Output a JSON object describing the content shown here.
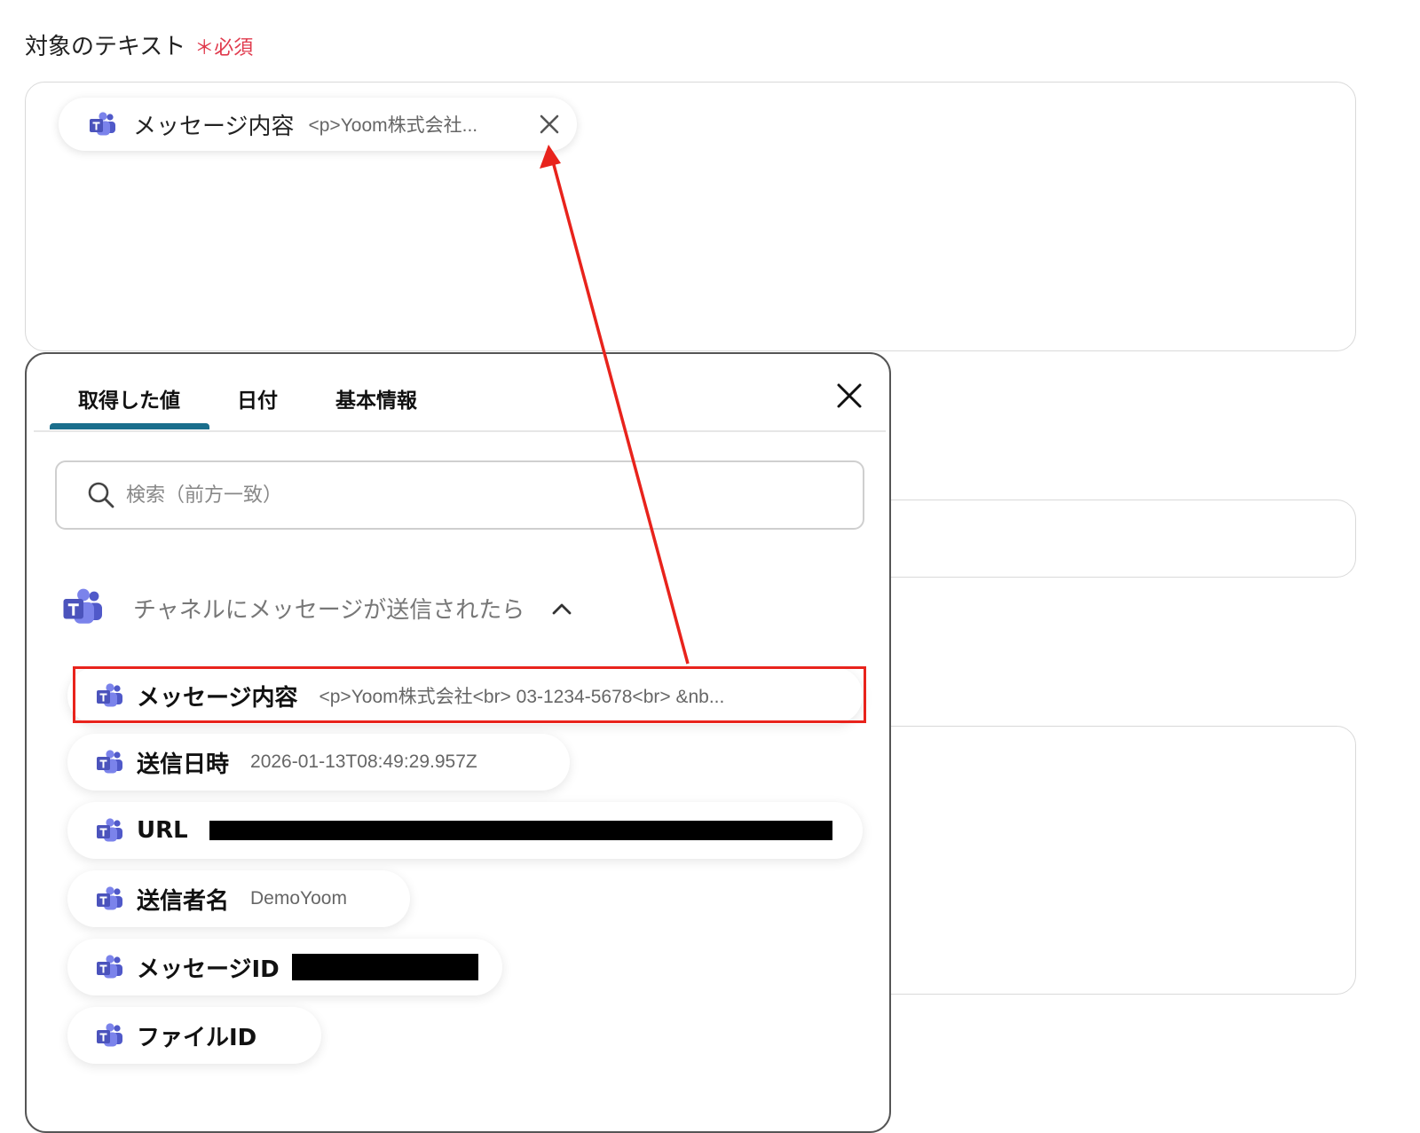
{
  "field": {
    "label": "対象のテキスト",
    "required_marker": "＊必須",
    "selected_chip": {
      "name": "メッセージ内容",
      "value": "<p>Yoom株式会社...",
      "icon": "teams-icon"
    }
  },
  "panel": {
    "tabs": [
      {
        "label": "取得した値",
        "active": true
      },
      {
        "label": "日付",
        "active": false
      },
      {
        "label": "基本情報",
        "active": false
      }
    ],
    "search": {
      "placeholder": "検索（前方一致）",
      "value": ""
    },
    "group": {
      "title": "チャネルにメッセージが送信されたら",
      "expanded": true,
      "icon": "teams-icon"
    },
    "items": [
      {
        "name": "メッセージ内容",
        "value": "<p>Yoom株式会社<br> 03-1234-5678<br> &nb...",
        "highlighted": true
      },
      {
        "name": "送信日時",
        "value": "2026-01-13T08:49:29.957Z"
      },
      {
        "name": "URL",
        "value": "",
        "redacted": true
      },
      {
        "name": "送信者名",
        "value": "DemoYoom"
      },
      {
        "name": "メッセージID",
        "value": "",
        "redacted": true
      },
      {
        "name": "ファイルID",
        "value": ""
      }
    ]
  },
  "colors": {
    "required": "#e03a4d",
    "tab_active_underline": "#1a6e8c",
    "annotation": "#e8231c",
    "teams_purple": "#5059c9"
  }
}
